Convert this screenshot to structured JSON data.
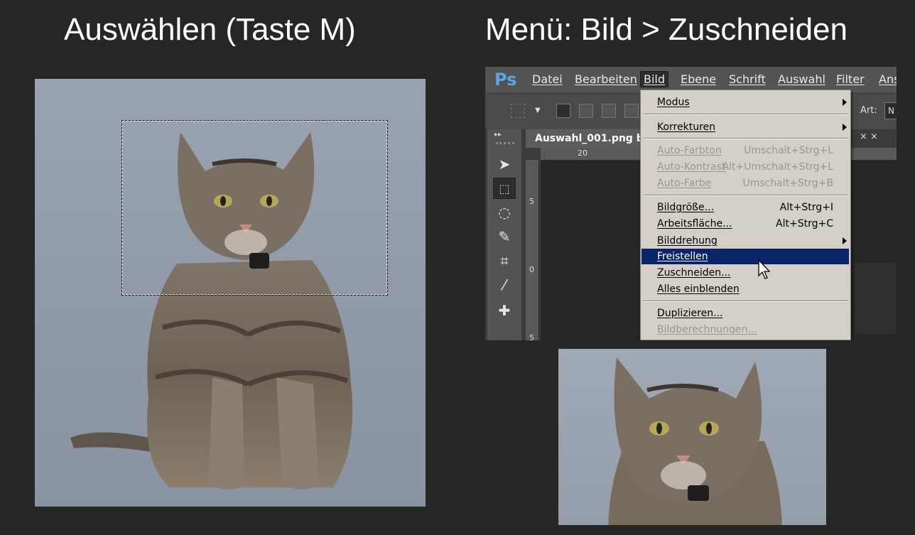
{
  "headings": {
    "left": "Auswählen (Taste M)",
    "right": "Menü: Bild > Zuschneiden"
  },
  "photoshop": {
    "logo": "Ps",
    "menubar": [
      "Datei",
      "Bearbeiten",
      "Bild",
      "Ebene",
      "Schrift",
      "Auswahl",
      "Filter",
      "Ans"
    ],
    "active_menu": "Bild",
    "options_bar": {
      "art_label": "Art:",
      "art_value": "N"
    },
    "document_tab": "Auswahl_001.png b",
    "tab_close": "× ×",
    "ruler": {
      "top": "20",
      "left": [
        "5",
        "0",
        "5"
      ]
    },
    "dropdown": [
      {
        "label": "Modus",
        "submenu": true,
        "state": "normal"
      },
      {
        "label": "Korrekturen",
        "submenu": true,
        "state": "normal"
      },
      {
        "label": "Auto-Farbton",
        "shortcut": "Umschalt+Strg+L",
        "state": "disabled"
      },
      {
        "label": "Auto-Kontrast",
        "shortcut": "Alt+Umschalt+Strg+L",
        "state": "disabled"
      },
      {
        "label": "Auto-Farbe",
        "shortcut": "Umschalt+Strg+B",
        "state": "disabled"
      },
      {
        "label": "Bildgröße...",
        "shortcut": "Alt+Strg+I",
        "state": "normal"
      },
      {
        "label": "Arbeitsfläche...",
        "shortcut": "Alt+Strg+C",
        "state": "normal"
      },
      {
        "label": "Bilddrehung",
        "submenu": true,
        "state": "normal"
      },
      {
        "label": "Freistellen",
        "state": "highlighted"
      },
      {
        "label": "Zuschneiden...",
        "state": "normal"
      },
      {
        "label": "Alles einblenden",
        "state": "normal"
      },
      {
        "label": "Duplizieren...",
        "state": "normal"
      },
      {
        "label": "Bildberechnungen...",
        "state": "disabled"
      }
    ]
  },
  "colors": {
    "background": "#262626",
    "menu_highlight": "#0a246a",
    "ps_logo": "#58a6e8"
  }
}
